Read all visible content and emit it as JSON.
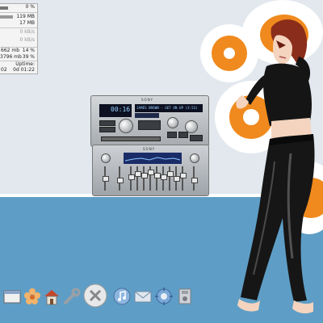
{
  "monitor": {
    "cpu_percent": "0 %",
    "mem_used": "119 MB",
    "mem_total": "17 MB",
    "net_in": "0 kB/s",
    "net_out": "0 kB/s",
    "disk1_size": "662 mb",
    "disk1_percent": "14 %",
    "disk2_size": "3796 mb",
    "disk2_percent": "39 %",
    "uptime_label": "Uptime:",
    "uptime_partial": "02",
    "uptime_value": "0d 01:22"
  },
  "player": {
    "brand": "SONY",
    "time": "00:16",
    "track": "JAMES BROWN - GET ON UP (3:53)",
    "eq_brand": "SONY"
  },
  "dock": {
    "items": [
      "window-icon",
      "flower-icon",
      "home-icon",
      "wrench-icon",
      "close-icon",
      "music-icon",
      "mail-icon",
      "settings-icon",
      "disk-icon"
    ]
  },
  "colors": {
    "accent": "#f08a1e",
    "floor": "#5e9ec6",
    "wall": "#e2e8ee"
  }
}
